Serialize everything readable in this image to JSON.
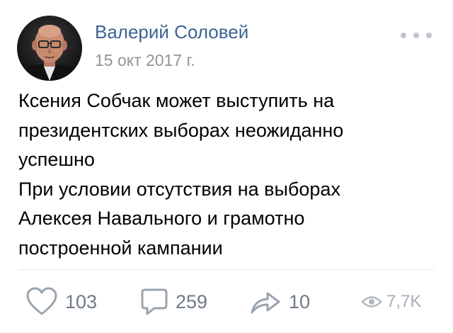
{
  "post": {
    "author": {
      "name": "Валерий Соловей",
      "avatar": "profile-photo"
    },
    "date": "15 окт 2017 г.",
    "text_lines": [
      "Ксения Собчак может выступить на",
      "президентских выборах неожиданно",
      "успешно",
      "При условии отсутствия на выборах",
      "Алексея Навального и грамотно",
      "построенной кампании"
    ],
    "actions": {
      "likes": "103",
      "comments": "259",
      "shares": "10",
      "views": "7,7K"
    },
    "icons": {
      "like": "heart-icon",
      "comment": "comment-icon",
      "share": "share-arrow-icon",
      "views": "eye-icon",
      "more": "more-dots-icon"
    },
    "colors": {
      "author_name": "#3d6391",
      "date": "#939393",
      "action_icon": "#9aa4af",
      "action_count": "#707b87",
      "views": "#a6adb5",
      "divider": "#e3e5e8"
    }
  }
}
